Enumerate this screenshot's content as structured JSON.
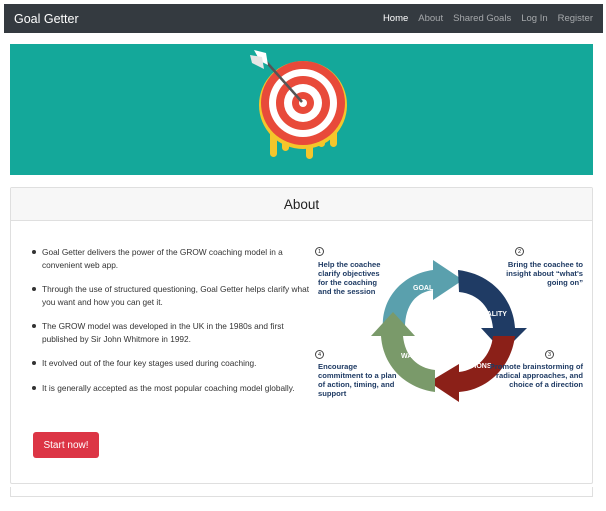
{
  "navbar": {
    "brand": "Goal Getter",
    "links": [
      "Home",
      "About",
      "Shared Goals",
      "Log In",
      "Register"
    ]
  },
  "card": {
    "title": "About",
    "bullets": [
      "Goal Getter delivers the power of the GROW coaching model in a convenient web app.",
      "Through the use of structured questioning, Goal Getter helps clarify what you want and how you can get it.",
      "The GROW model was developed in the UK in the 1980s and first published by Sir John Whitmore in 1992.",
      "It evolved out of the four key stages used during coaching.",
      "It is generally accepted as the most popular coaching model globally."
    ],
    "cta": "Start now!"
  },
  "grow_model": {
    "stages": [
      "GOAL",
      "REALITY",
      "OPTIONS",
      "WAY"
    ],
    "numbers": [
      "1",
      "2",
      "3",
      "4"
    ],
    "descriptions": [
      "Help the coachee clarify objectives for the coaching and the session",
      "Bring the coachee to insight about “what's going on”",
      "Promote brainstorming of radical approaches, and choice of a direction",
      "Encourage commitment to a plan of action, timing, and support"
    ]
  },
  "colors": {
    "navbar": "#343a40",
    "banner": "#14a89a",
    "cta": "#dc3545",
    "goal": "#5aa0ad",
    "reality": "#1f3b64",
    "options": "#8b2018",
    "way": "#7a9a6a"
  },
  "icons": [
    "target-arrow-logo"
  ]
}
